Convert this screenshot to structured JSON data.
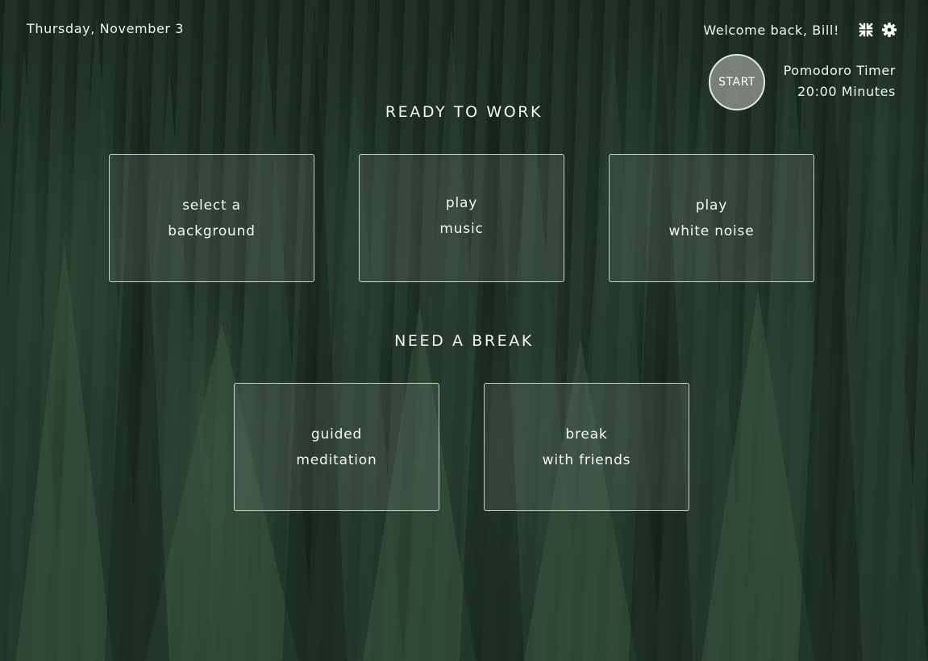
{
  "header": {
    "date": "Thursday, November 3",
    "welcome": "Welcome back, Bill!",
    "icons": [
      "compress-icon",
      "gear-icon"
    ]
  },
  "timer": {
    "start_label": "START",
    "title": "Pomodoro Timer",
    "duration": "20:00 Minutes"
  },
  "work": {
    "title": "READY TO WORK",
    "cards": [
      {
        "line1": "select a",
        "line2": "background"
      },
      {
        "line1": "play",
        "line2": "music"
      },
      {
        "line1": "play",
        "line2": "white noise"
      }
    ]
  },
  "break": {
    "title": "NEED A BREAK",
    "cards": [
      {
        "line1": "guided",
        "line2": "meditation"
      },
      {
        "line1": "break",
        "line2": "with friends"
      }
    ]
  },
  "colors": {
    "text": "#f1f3f1",
    "background": "#1b2d22",
    "card_border": "#e2e8e2"
  }
}
